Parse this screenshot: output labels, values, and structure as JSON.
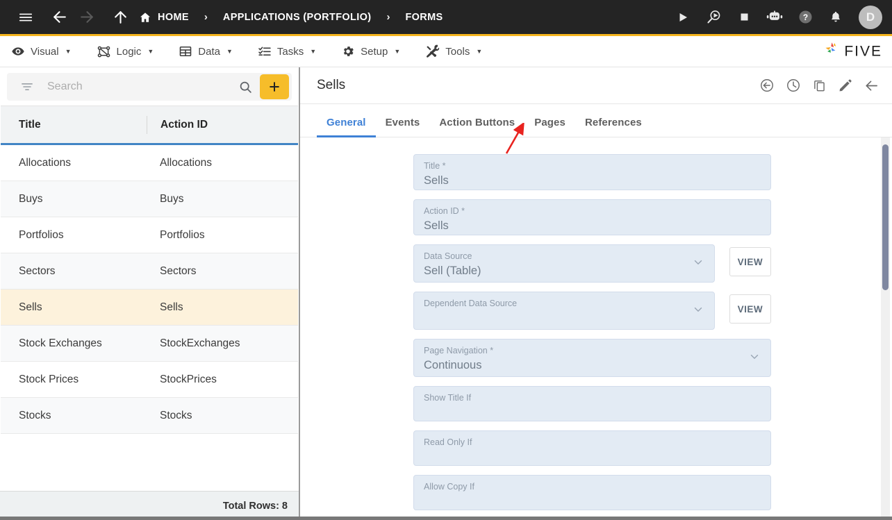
{
  "topbar": {
    "menu_icon": "hamburger-icon",
    "back_icon": "arrow-left-icon",
    "forward_icon": "arrow-right-icon",
    "up_icon": "arrow-up-icon",
    "home_label": "HOME",
    "breadcrumb": [
      "HOME",
      "APPLICATIONS (PORTFOLIO)",
      "FORMS"
    ],
    "separator": "›",
    "actions": [
      {
        "name": "run-icon",
        "label": "Run"
      },
      {
        "name": "debug-run-icon",
        "label": "Debug"
      },
      {
        "name": "stop-icon",
        "label": "Stop"
      },
      {
        "name": "robot-assistant-icon",
        "label": "Assistant"
      },
      {
        "name": "help-icon",
        "label": "Help"
      },
      {
        "name": "notifications-bell-icon",
        "label": "Notifications"
      }
    ],
    "avatar_initial": "D",
    "accent_color": "#F5B51E",
    "background_color": "#242424"
  },
  "menubar": {
    "items": [
      {
        "label": "Visual",
        "icon": "eye-icon"
      },
      {
        "label": "Logic",
        "icon": "flow-nodes-icon"
      },
      {
        "label": "Data",
        "icon": "table-grid-icon"
      },
      {
        "label": "Tasks",
        "icon": "checklist-icon"
      },
      {
        "label": "Setup",
        "icon": "gear-icon"
      },
      {
        "label": "Tools",
        "icon": "wrench-screwdriver-icon"
      }
    ],
    "caret": "▼",
    "brand": "FIVE"
  },
  "sidebar": {
    "search": {
      "placeholder": "Search",
      "value": "",
      "filter_icon": "filter-icon",
      "search_icon": "search-icon",
      "add_label": "+"
    },
    "columns": [
      "Title",
      "Action ID"
    ],
    "rows": [
      {
        "title": "Allocations",
        "action_id": "Allocations",
        "selected": false
      },
      {
        "title": "Buys",
        "action_id": "Buys",
        "selected": false
      },
      {
        "title": "Portfolios",
        "action_id": "Portfolios",
        "selected": false
      },
      {
        "title": "Sectors",
        "action_id": "Sectors",
        "selected": false
      },
      {
        "title": "Sells",
        "action_id": "Sells",
        "selected": true
      },
      {
        "title": "Stock Exchanges",
        "action_id": "StockExchanges",
        "selected": false
      },
      {
        "title": "Stock Prices",
        "action_id": "StockPrices",
        "selected": false
      },
      {
        "title": "Stocks",
        "action_id": "Stocks",
        "selected": false
      }
    ],
    "total_rows_label": "Total Rows: 8",
    "selected_row_color": "#fdf2dc",
    "header_underline_color": "#4285c5"
  },
  "detail": {
    "title": "Sells",
    "header_icons": [
      {
        "name": "revert-icon",
        "label": "Revert"
      },
      {
        "name": "history-clock-icon",
        "label": "History"
      },
      {
        "name": "duplicate-copy-icon",
        "label": "Duplicate"
      },
      {
        "name": "edit-pencil-icon",
        "label": "Edit"
      },
      {
        "name": "close-back-arrow-icon",
        "label": "Back"
      }
    ],
    "tabs": [
      {
        "label": "General",
        "active": true
      },
      {
        "label": "Events",
        "active": false
      },
      {
        "label": "Action Buttons",
        "active": false
      },
      {
        "label": "Pages",
        "active": false
      },
      {
        "label": "References",
        "active": false
      }
    ],
    "active_tab_color": "#3f81d6",
    "fields": [
      {
        "label": "Title *",
        "value": "Sells",
        "type": "text",
        "view_button": null
      },
      {
        "label": "Action ID *",
        "value": "Sells",
        "type": "text",
        "view_button": null
      },
      {
        "label": "Data Source",
        "value": "Sell (Table)",
        "type": "select",
        "view_button": "VIEW"
      },
      {
        "label": "Dependent Data Source",
        "value": "",
        "type": "select",
        "view_button": "VIEW"
      },
      {
        "label": "Page Navigation *",
        "value": "Continuous",
        "type": "select",
        "view_button": null
      },
      {
        "label": "Show Title If",
        "value": "",
        "type": "text",
        "view_button": null
      },
      {
        "label": "Read Only If",
        "value": "",
        "type": "text",
        "view_button": null
      },
      {
        "label": "Allow Copy If",
        "value": "",
        "type": "text",
        "view_button": null
      }
    ],
    "annotation": {
      "type": "red-arrow",
      "points_to": "Pages",
      "color": "#e8231f"
    }
  }
}
